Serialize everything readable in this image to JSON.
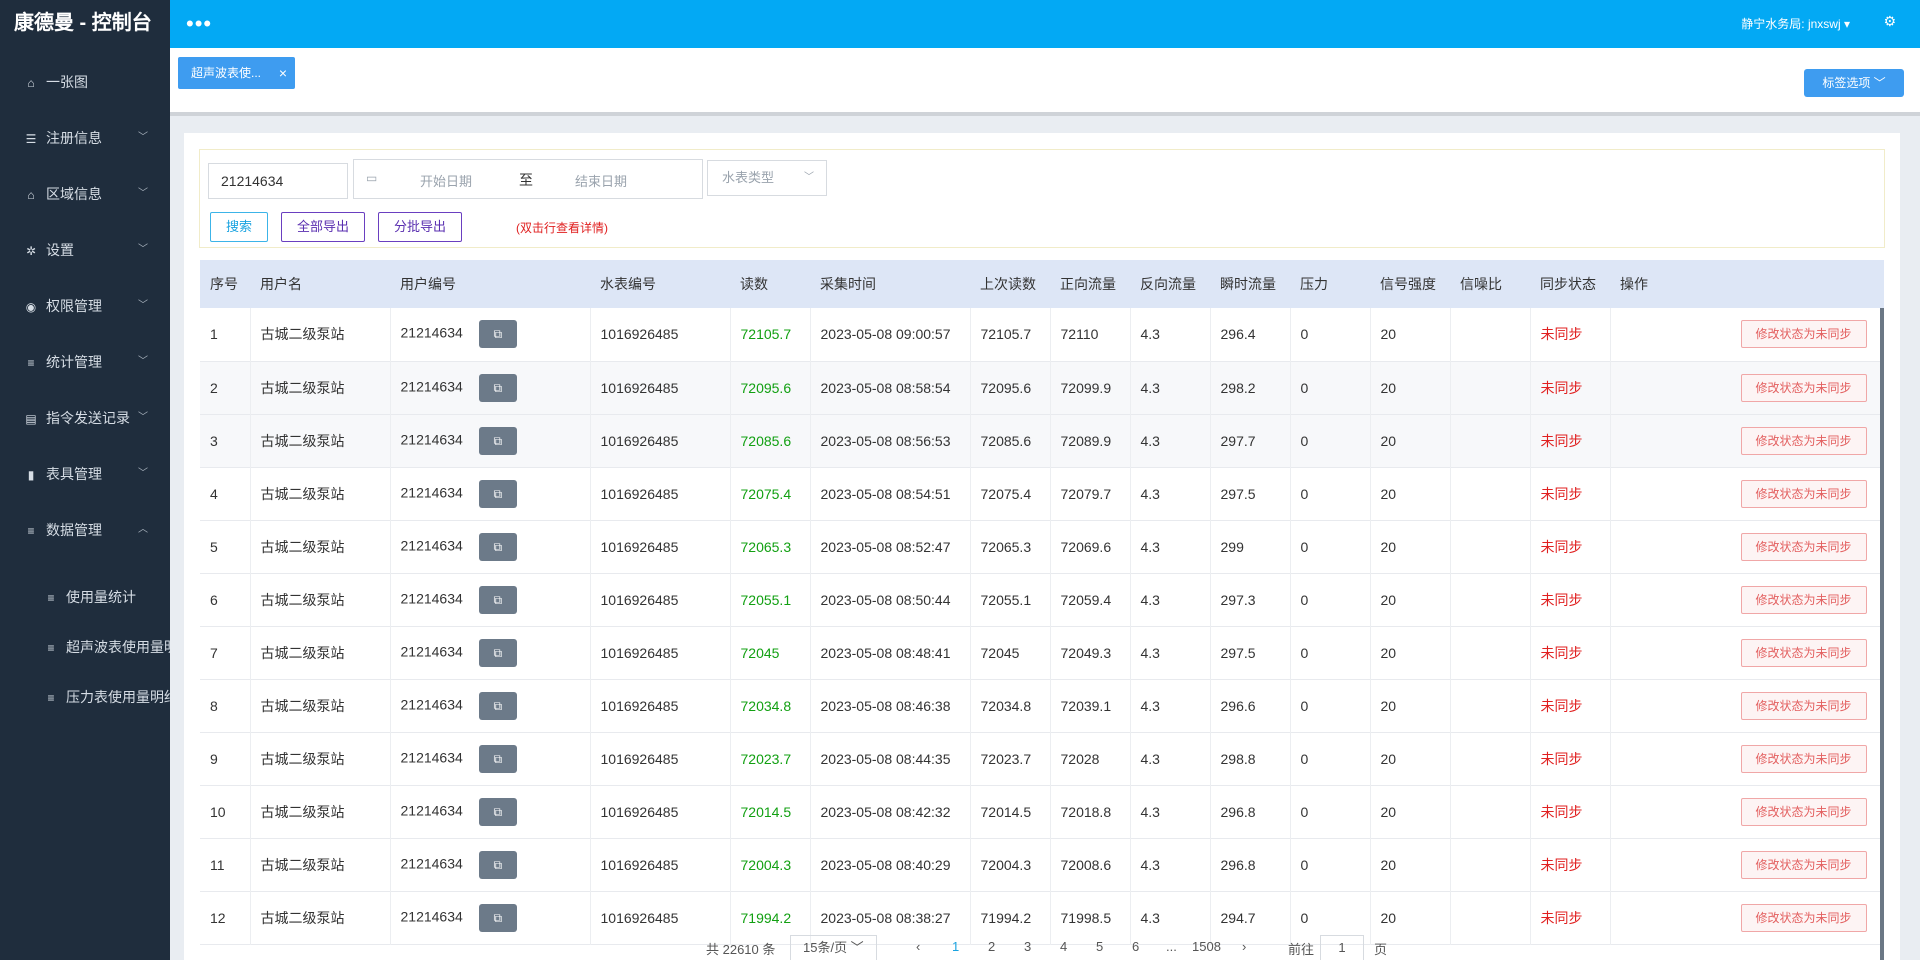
{
  "app": {
    "title": "康德曼 - 控制台"
  },
  "header": {
    "menu_dots": "•••",
    "user": "静宁水务局: jnxswj ▾",
    "settings_icon": "⚙"
  },
  "sidebar": {
    "items": [
      {
        "label": "一张图",
        "icon": "home-icon",
        "glyph": "⌂",
        "chevron": ""
      },
      {
        "label": "注册信息",
        "icon": "list-icon",
        "glyph": "☰",
        "chevron": "﹀"
      },
      {
        "label": "区域信息",
        "icon": "bank-icon",
        "glyph": "⌂",
        "chevron": "﹀"
      },
      {
        "label": "设置",
        "icon": "gear-icon",
        "glyph": "✲",
        "chevron": "﹀"
      },
      {
        "label": "权限管理",
        "icon": "user-circle-icon",
        "glyph": "◉",
        "chevron": "﹀"
      },
      {
        "label": "统计管理",
        "icon": "database-icon",
        "glyph": "≡",
        "chevron": "﹀"
      },
      {
        "label": "指令发送记录",
        "icon": "terminal-icon",
        "glyph": "▤",
        "chevron": "﹀"
      },
      {
        "label": "表具管理",
        "icon": "cylinder-icon",
        "glyph": "▮",
        "chevron": "﹀"
      },
      {
        "label": "数据管理",
        "icon": "database-icon",
        "glyph": "≡",
        "chevron": "︿"
      }
    ],
    "sub_items": [
      {
        "label": "使用量统计",
        "icon": "database-icon",
        "glyph": "≡"
      },
      {
        "label": "超声波表使用量明细",
        "icon": "database-icon",
        "glyph": "≡"
      },
      {
        "label": "压力表使用量明细",
        "icon": "database-icon",
        "glyph": "≡"
      }
    ]
  },
  "tabs": {
    "active_label": "超声波表使...",
    "close": "×",
    "options_label": "标签选项 ﹀"
  },
  "filters": {
    "search_value": "21214634",
    "date_start_placeholder": "开始日期",
    "date_sep": "至",
    "date_end_placeholder": "结束日期",
    "type_placeholder": "水表类型",
    "type_caret": "﹀",
    "calendar_glyph": "▭",
    "search_button": "搜索",
    "export_all_button": "全部导出",
    "export_batch_button": "分批导出",
    "hint": "(双击行查看详情)"
  },
  "table": {
    "columns": [
      "序号",
      "用户名",
      "用户编号",
      "水表编号",
      "读数",
      "采集时间",
      "上次读数",
      "正向流量",
      "反向流量",
      "瞬时流量",
      "压力",
      "信号强度",
      "信噪比",
      "同步状态",
      "操作"
    ],
    "copy_glyph": "⧉",
    "action_label": "修改状态为未同步",
    "rows": [
      [
        "1",
        "古城二级泵站",
        "21214634",
        "1016926485",
        "72105.7",
        "2023-05-08 09:00:57",
        "72105.7",
        "72110",
        "4.3",
        "296.4",
        "0",
        "20",
        "",
        "未同步"
      ],
      [
        "2",
        "古城二级泵站",
        "21214634",
        "1016926485",
        "72095.6",
        "2023-05-08 08:58:54",
        "72095.6",
        "72099.9",
        "4.3",
        "298.2",
        "0",
        "20",
        "",
        "未同步"
      ],
      [
        "3",
        "古城二级泵站",
        "21214634",
        "1016926485",
        "72085.6",
        "2023-05-08 08:56:53",
        "72085.6",
        "72089.9",
        "4.3",
        "297.7",
        "0",
        "20",
        "",
        "未同步"
      ],
      [
        "4",
        "古城二级泵站",
        "21214634",
        "1016926485",
        "72075.4",
        "2023-05-08 08:54:51",
        "72075.4",
        "72079.7",
        "4.3",
        "297.5",
        "0",
        "20",
        "",
        "未同步"
      ],
      [
        "5",
        "古城二级泵站",
        "21214634",
        "1016926485",
        "72065.3",
        "2023-05-08 08:52:47",
        "72065.3",
        "72069.6",
        "4.3",
        "299",
        "0",
        "20",
        "",
        "未同步"
      ],
      [
        "6",
        "古城二级泵站",
        "21214634",
        "1016926485",
        "72055.1",
        "2023-05-08 08:50:44",
        "72055.1",
        "72059.4",
        "4.3",
        "297.3",
        "0",
        "20",
        "",
        "未同步"
      ],
      [
        "7",
        "古城二级泵站",
        "21214634",
        "1016926485",
        "72045",
        "2023-05-08 08:48:41",
        "72045",
        "72049.3",
        "4.3",
        "297.5",
        "0",
        "20",
        "",
        "未同步"
      ],
      [
        "8",
        "古城二级泵站",
        "21214634",
        "1016926485",
        "72034.8",
        "2023-05-08 08:46:38",
        "72034.8",
        "72039.1",
        "4.3",
        "296.6",
        "0",
        "20",
        "",
        "未同步"
      ],
      [
        "9",
        "古城二级泵站",
        "21214634",
        "1016926485",
        "72023.7",
        "2023-05-08 08:44:35",
        "72023.7",
        "72028",
        "4.3",
        "298.8",
        "0",
        "20",
        "",
        "未同步"
      ],
      [
        "10",
        "古城二级泵站",
        "21214634",
        "1016926485",
        "72014.5",
        "2023-05-08 08:42:32",
        "72014.5",
        "72018.8",
        "4.3",
        "296.8",
        "0",
        "20",
        "",
        "未同步"
      ],
      [
        "11",
        "古城二级泵站",
        "21214634",
        "1016926485",
        "72004.3",
        "2023-05-08 08:40:29",
        "72004.3",
        "72008.6",
        "4.3",
        "296.8",
        "0",
        "20",
        "",
        "未同步"
      ],
      [
        "12",
        "古城二级泵站",
        "21214634",
        "1016926485",
        "71994.2",
        "2023-05-08 08:38:27",
        "71994.2",
        "71998.5",
        "4.3",
        "294.7",
        "0",
        "20",
        "",
        "未同步"
      ]
    ]
  },
  "pagination": {
    "total": "共 22610 条",
    "page_size": "15条/页 ﹀",
    "prev": "‹",
    "pages": [
      "1",
      "2",
      "3",
      "4",
      "5",
      "6",
      "...",
      "1508"
    ],
    "next": "›",
    "jump_label": "前往",
    "jump_value": "1",
    "jump_suffix": "页"
  }
}
